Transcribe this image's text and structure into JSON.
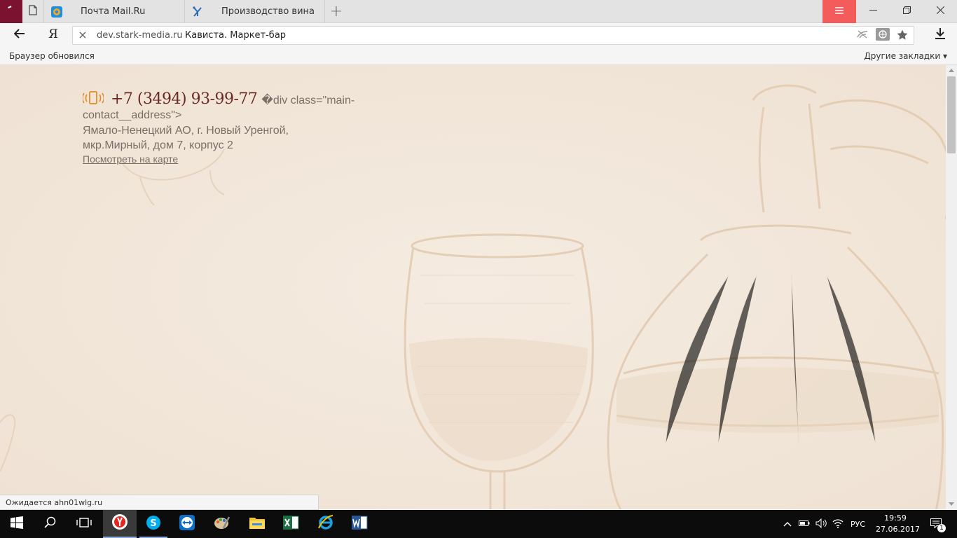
{
  "tabs": {
    "pinned_icon": "page-icon",
    "items": [
      {
        "title": "Почта Mail.Ru",
        "icon": "mailru-icon"
      },
      {
        "title": "Производство вина",
        "icon": "wine-site-icon"
      }
    ],
    "new_tab_label": "+"
  },
  "window_controls": {
    "menu": "menu-icon",
    "minimize": "minimize-icon",
    "restore": "restore-icon",
    "close": "close-icon"
  },
  "navigation": {
    "browser_logo": "Я",
    "host": "dev.stark-media.ru",
    "page_title": "Кависта. Маркет-бар"
  },
  "bookmarks": {
    "notice": "Браузер обновился",
    "other": "Другие закладки ▾"
  },
  "page": {
    "phone": "+7 (3494) 93-99-77",
    "raw_html_part1": "�div class=\"main-",
    "raw_html_part2": "contact__address\">",
    "address_line1": "Ямало-Ненецкий АО, г. Новый Уренгой,",
    "address_line2": "мкр.Мирный, дом 7, корпус 2",
    "map_link": "Посмотреть на карте",
    "background_color": "#f3e8dc",
    "accent_color": "#6b2a25"
  },
  "status_bar": "Ожидается ahn01wlg.ru",
  "taskbar": {
    "apps": [
      "windows-start-icon",
      "search-icon",
      "task-view-icon",
      "yandex-browser-icon",
      "skype-icon",
      "teamviewer-icon",
      "paint-icon",
      "file-explorer-icon",
      "excel-icon",
      "internet-explorer-icon",
      "word-icon"
    ],
    "language": "РУС",
    "time": "19:59",
    "date": "27.06.2017",
    "notifications_count": "1"
  }
}
